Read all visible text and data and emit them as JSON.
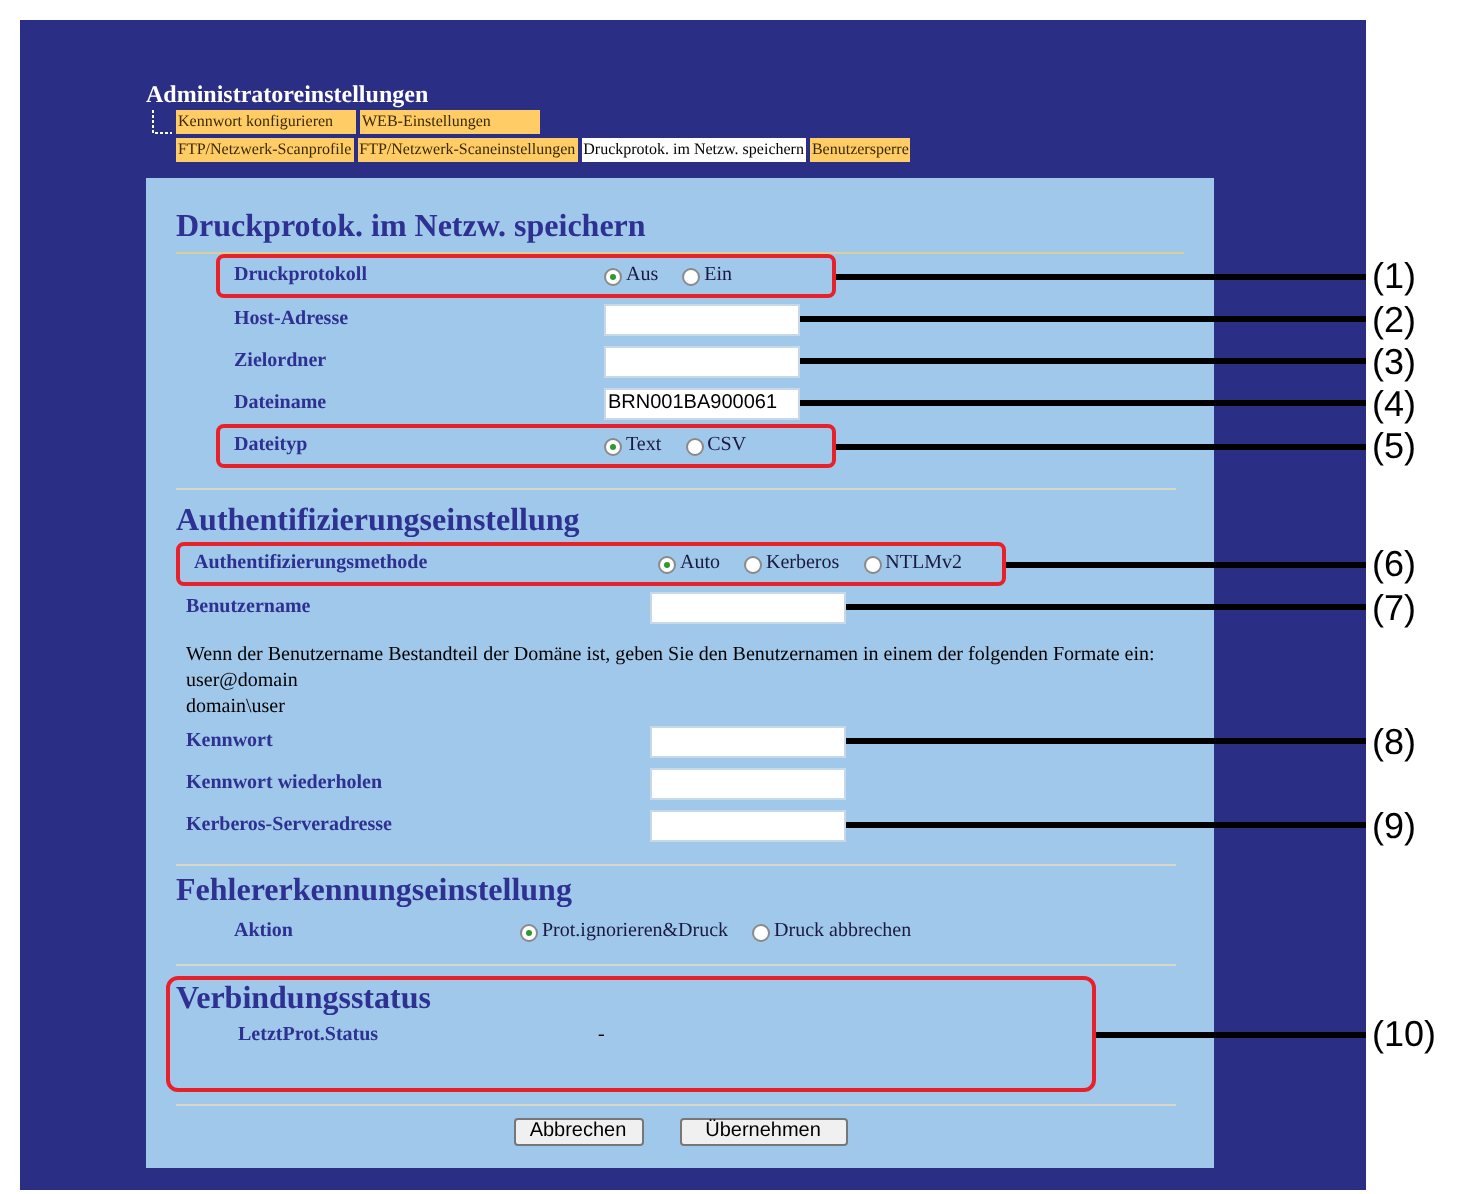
{
  "header": {
    "title": "Administratoreinstellungen",
    "tab_rows": [
      [
        {
          "label": "Kennwort konfigurieren",
          "selected": false
        },
        {
          "label": "WEB-Einstellungen",
          "selected": false
        }
      ],
      [
        {
          "label": "FTP/Netzwerk-Scanprofile",
          "selected": false
        },
        {
          "label": "FTP/Netzwerk-Scaneinstellungen",
          "selected": false
        },
        {
          "label": "Druckprotok. im Netzw. speichern",
          "selected": true
        },
        {
          "label": "Benutzersperre",
          "selected": false
        }
      ]
    ]
  },
  "sections": [
    {
      "title": "Druckprotok. im Netzw. speichern",
      "highlighted": false,
      "rows": [
        {
          "kind": "radio",
          "label": "Druckprotokoll",
          "highlighted": true,
          "callout": "(1)",
          "options": [
            {
              "label": "Aus",
              "selected": true
            },
            {
              "label": "Ein",
              "selected": false
            }
          ]
        },
        {
          "kind": "field",
          "label": "Host-Adresse",
          "callout": "(2)"
        },
        {
          "kind": "field",
          "label": "Zielordner",
          "callout": "(3)"
        },
        {
          "kind": "field",
          "label": "Dateiname",
          "value": "BRN001BA900061",
          "callout": "(4)"
        },
        {
          "kind": "radio",
          "label": "Dateityp",
          "highlighted": true,
          "callout": "(5)",
          "options": [
            {
              "label": "Text",
              "selected": true
            },
            {
              "label": "CSV",
              "selected": false
            }
          ]
        }
      ]
    },
    {
      "title": "Authentifizierungseinstellung",
      "highlighted": false,
      "rows": [
        {
          "kind": "radio",
          "label": "Authentifizierungsmethode",
          "highlighted": true,
          "callout": "(6)",
          "options": [
            {
              "label": "Auto",
              "selected": true
            },
            {
              "label": "Kerberos",
              "selected": false
            },
            {
              "label": "NTLMv2",
              "selected": false
            }
          ]
        },
        {
          "kind": "field",
          "label": "Benutzername",
          "callout": "(7)"
        },
        {
          "kind": "note",
          "lines": [
            "Wenn der Benutzername Bestandteil der Domäne ist, geben Sie den Benutzernamen in einem der folgenden Formate ein:",
            "user@domain",
            "domain\\user"
          ]
        },
        {
          "kind": "field",
          "label": "Kennwort",
          "callout": "(8)"
        },
        {
          "kind": "field",
          "label": "Kennwort wiederholen"
        },
        {
          "kind": "field",
          "label": "Kerberos-Serveradresse",
          "callout": "(9)"
        }
      ]
    },
    {
      "title": "Fehlererkennungseinstellung",
      "highlighted": false,
      "rows": [
        {
          "kind": "radio",
          "label": "Aktion",
          "options": [
            {
              "label": "Prot.ignorieren&Druck",
              "selected": true
            },
            {
              "label": "Druck abbrechen",
              "selected": false
            }
          ]
        }
      ]
    },
    {
      "title": "Verbindungsstatus",
      "highlighted": true,
      "callout": "(10)",
      "rows": [
        {
          "kind": "status",
          "label": "LetztProt.Status",
          "value": "-"
        }
      ]
    }
  ],
  "buttons": [
    "Abbrechen",
    "Übernehmen"
  ]
}
